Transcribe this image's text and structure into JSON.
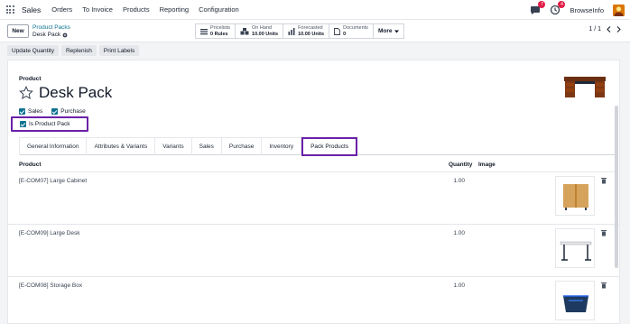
{
  "navbar": {
    "app_name": "Sales",
    "menu": [
      "Orders",
      "To Invoice",
      "Products",
      "Reporting",
      "Configuration"
    ],
    "chat_badge": "7",
    "activity_badge": "4",
    "company": "BrowseInfo"
  },
  "control": {
    "new_label": "New",
    "breadcrumb": "Product Packs",
    "record_name": "Desk Pack",
    "smart_buttons": [
      {
        "icon": "list-icon",
        "line1": "Pricelists",
        "line2": "0 Rules"
      },
      {
        "icon": "cubes-icon",
        "line1": "On Hand",
        "line2": "10.00 Units"
      },
      {
        "icon": "chart-icon",
        "line1": "Forecasted",
        "line2": "10.00 Units"
      },
      {
        "icon": "document-icon",
        "line1": "Documents",
        "line2": "0"
      }
    ],
    "more_label": "More",
    "pager": "1 / 1"
  },
  "actions": [
    "Update Quantity",
    "Replenish",
    "Print Labels"
  ],
  "form": {
    "product_label": "Product",
    "name": "Desk Pack",
    "sales_label": "Sales",
    "purchase_label": "Purchase",
    "pack_label": "Is Product Pack",
    "tabs": [
      "General Information",
      "Attributes & Variants",
      "Variants",
      "Sales",
      "Purchase",
      "Inventory",
      "Pack Products"
    ],
    "active_tab": "Pack Products"
  },
  "pack_list": {
    "headers": {
      "product": "Product",
      "quantity": "Quantity",
      "image": "Image"
    },
    "rows": [
      {
        "product": "[E-COM07] Large Cabinet",
        "quantity": "1.00",
        "image": "cabinet-image"
      },
      {
        "product": "[E-COM09] Large Desk",
        "quantity": "1.00",
        "image": "desk-image"
      },
      {
        "product": "[E-COM08] Storage Box",
        "quantity": "1.00",
        "image": "storage-box-image"
      }
    ]
  },
  "colors": {
    "accent": "#0e7490",
    "highlight": "#6b21a8",
    "badge": "#e11d48"
  }
}
